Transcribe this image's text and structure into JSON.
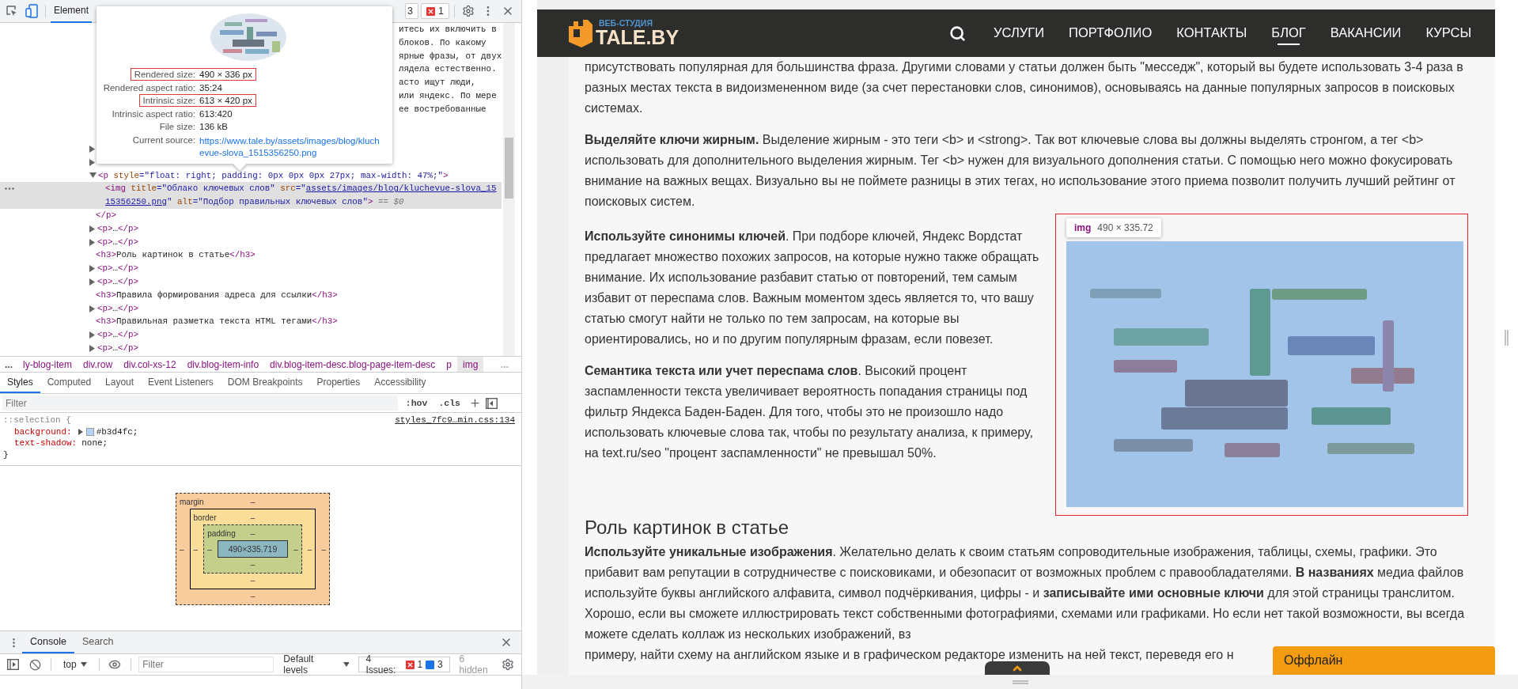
{
  "devtools": {
    "toolbar": {
      "tabs": [
        {
          "label": "Element",
          "selected": true
        }
      ],
      "warning_count": "3",
      "error_count": "1"
    },
    "tree_tail_lines": [
      "итесь их включить в",
      "блоков. По какому",
      "ярные фразы, от двух",
      "лядела естественно.",
      "асто ищут люди,",
      "или яндекс. По мере",
      "ее востребованные"
    ],
    "tree": [
      {
        "expanded": false,
        "selected": false
      },
      {
        "expanded": false,
        "selected": false
      },
      {
        "expanded": true,
        "selected": false,
        "segments": [
          {
            "kind": "tag",
            "text": "<p"
          },
          {
            "kind": "attr",
            "text": " style"
          },
          {
            "kind": "value",
            "text": "=\"float: right; padding: 0px 0px 0px 27px; max-width: 47%;\""
          },
          {
            "kind": "tag",
            "text": ">"
          }
        ],
        "closing": "</p>",
        "children": [
          {
            "selected": true,
            "segments": [
              {
                "kind": "tag",
                "text": "<img"
              },
              {
                "kind": "attr",
                "text": " title"
              },
              {
                "kind": "value",
                "text": "=\"Облако ключевых слов\""
              },
              {
                "kind": "attr",
                "text": " src"
              },
              {
                "kind": "value",
                "text": "=\""
              },
              {
                "kind": "link",
                "text": "assets/images/blog/kluchevue-slova_1515356250.png"
              },
              {
                "kind": "value",
                "text": "\""
              },
              {
                "kind": "attr",
                "text": " alt"
              },
              {
                "kind": "value",
                "text": "=\"Подбор правильных ключевых слов\""
              },
              {
                "kind": "tag",
                "text": ">"
              },
              {
                "kind": "hint",
                "text": " == $0"
              }
            ]
          }
        ]
      },
      {
        "expanded": false,
        "selected": false,
        "segments": [
          {
            "kind": "tag",
            "text": "<p>"
          },
          {
            "kind": "text",
            "text": "…"
          },
          {
            "kind": "tag",
            "text": "</p>"
          }
        ]
      },
      {
        "expanded": false,
        "selected": false,
        "segments": [
          {
            "kind": "tag",
            "text": "<p>"
          },
          {
            "kind": "text",
            "text": "…"
          },
          {
            "kind": "tag",
            "text": "</p>"
          }
        ]
      },
      {
        "selected": false,
        "segments": [
          {
            "kind": "tag",
            "text": "<h3>"
          },
          {
            "kind": "text",
            "text": "Роль картинок в статье"
          },
          {
            "kind": "tag",
            "text": "</h3>"
          }
        ]
      },
      {
        "expanded": false,
        "selected": false,
        "segments": [
          {
            "kind": "tag",
            "text": "<p>"
          },
          {
            "kind": "text",
            "text": "…"
          },
          {
            "kind": "tag",
            "text": "</p>"
          }
        ]
      },
      {
        "expanded": false,
        "selected": false,
        "segments": [
          {
            "kind": "tag",
            "text": "<p>"
          },
          {
            "kind": "text",
            "text": "…"
          },
          {
            "kind": "tag",
            "text": "</p>"
          }
        ]
      },
      {
        "selected": false,
        "segments": [
          {
            "kind": "tag",
            "text": "<h3>"
          },
          {
            "kind": "text",
            "text": "Правила формирования адреса для ссылки"
          },
          {
            "kind": "tag",
            "text": "</h3>"
          }
        ]
      },
      {
        "expanded": false,
        "selected": false,
        "segments": [
          {
            "kind": "tag",
            "text": "<p>"
          },
          {
            "kind": "text",
            "text": "…"
          },
          {
            "kind": "tag",
            "text": "</p>"
          }
        ]
      },
      {
        "selected": false,
        "segments": [
          {
            "kind": "tag",
            "text": "<h3>"
          },
          {
            "kind": "text",
            "text": "Правильная разметка текста HTML тегами"
          },
          {
            "kind": "tag",
            "text": "</h3>"
          }
        ]
      },
      {
        "expanded": false,
        "selected": false,
        "segments": [
          {
            "kind": "tag",
            "text": "<p>"
          },
          {
            "kind": "text",
            "text": "…"
          },
          {
            "kind": "tag",
            "text": "</p>"
          }
        ]
      },
      {
        "expanded": false,
        "selected": false,
        "segments": [
          {
            "kind": "tag",
            "text": "<p>"
          },
          {
            "kind": "text",
            "text": "…"
          },
          {
            "kind": "tag",
            "text": "</p>"
          }
        ]
      }
    ],
    "image_tooltip": {
      "rows": [
        {
          "label": "Rendered size:",
          "value": "490 × 336 px",
          "kind": "text",
          "highlighted": true
        },
        {
          "label": "Rendered aspect ratio:",
          "value": "35:24",
          "kind": "text",
          "highlighted": false
        },
        {
          "label": "Intrinsic size:",
          "value": "613 × 420 px",
          "kind": "text",
          "highlighted": true
        },
        {
          "label": "Intrinsic aspect ratio:",
          "value": "613:420",
          "kind": "text",
          "highlighted": false
        },
        {
          "label": "File size:",
          "value": "136 kB",
          "kind": "text",
          "highlighted": false
        },
        {
          "label": "Current source:",
          "value": "https://www.tale.by/assets/images/blog/kluchevue-slova_1515356250.png",
          "kind": "link",
          "highlighted": false
        }
      ]
    },
    "breadcrumbs": {
      "more_left": "...",
      "items": [
        {
          "label": "ly-blog-item",
          "selected": false
        },
        {
          "label": "div.row",
          "selected": false
        },
        {
          "label": "div.col-xs-12",
          "selected": false
        },
        {
          "label": "div.blog-item-info",
          "selected": false
        },
        {
          "label": "div.blog-item-desc.blog-page-item-desc",
          "selected": false
        },
        {
          "label": "p",
          "selected": false
        },
        {
          "label": "img",
          "selected": true
        }
      ],
      "more_right": "..."
    },
    "sidebar_tabs": [
      {
        "label": "Styles",
        "selected": true
      },
      {
        "label": "Computed",
        "selected": false
      },
      {
        "label": "Layout",
        "selected": false
      },
      {
        "label": "Event Listeners",
        "selected": false
      },
      {
        "label": "DOM Breakpoints",
        "selected": false
      },
      {
        "label": "Properties",
        "selected": false
      },
      {
        "label": "Accessibility",
        "selected": false
      }
    ],
    "styles_filter": {
      "placeholder": "Filter",
      "buttons": [
        ":hov",
        ".cls"
      ]
    },
    "rule": {
      "selector": "::selection {",
      "source": "styles_7fc9…min.css:134",
      "declarations": [
        {
          "property": "background:",
          "value": "#b3d4fc;",
          "color": "#b3d4fc"
        },
        {
          "property": "text-shadow:",
          "value": "none;"
        }
      ],
      "close": "}"
    },
    "box_model": {
      "margin": {
        "label": "margin",
        "top": "–",
        "left": "–",
        "right": "–",
        "bottom": "–"
      },
      "border": {
        "label": "border",
        "top": "–",
        "left": "–",
        "right": "–",
        "bottom": "–"
      },
      "padding": {
        "label": "padding",
        "top": "–",
        "left": "–",
        "right": "–",
        "bottom": "–"
      },
      "content": "490×335.719"
    },
    "drawer": {
      "tabs": [
        {
          "label": "Console",
          "selected": true
        },
        {
          "label": "Search",
          "selected": false
        }
      ],
      "context": "top",
      "filter_placeholder": "Filter",
      "levels": "Default levels",
      "issues_label": "4 Issues:",
      "issue_errors": "1",
      "issue_infos": "3",
      "hidden": "6 hidden"
    }
  },
  "website": {
    "logo": {
      "tagline": "ВЕБ-СТУДИЯ",
      "name": "TALE.BY"
    },
    "nav": [
      {
        "label": "УСЛУГИ",
        "selected": false
      },
      {
        "label": "ПОРТФОЛИО",
        "selected": false
      },
      {
        "label": "КОНТАКТЫ",
        "selected": false
      },
      {
        "label": "БЛОГ",
        "selected": true
      },
      {
        "label": "ВАКАНСИИ",
        "selected": false
      },
      {
        "label": "КУРСЫ",
        "selected": false
      }
    ],
    "paragraphs_top": [
      "присутствовать популярная для большинства фраза. Другими словами у статьи должен быть \"месседж\", который вы будете использовать 3-4 раза в разных местах текста в видоизмененном виде (за счет перестановки слов, синонимов), основываясь на данные популярных запросов в поисковых системах.",
      "**Выделяйте ключи жирным.** Выделение жирным - это теги <b> и <strong>. Так вот ключевые слова вы должны выделять стронгом, а тег <b> использовать для дополнительного выделения жирным. Тег <b> нужен для визуального дополнения статьи. С помощью него можно фокусировать внимание на важных вещах. Визуально вы не поймете разницы в этих тегах, но использование этого приема позволит получить лучший рейтинг от поисковых систем."
    ],
    "figure": {
      "badge_tag": "img",
      "badge_size": "490 × 335.72"
    },
    "side_paragraphs": [
      "**Используйте синонимы ключей**. При подборе ключей, Яндекс Вордстат предлагает множество похожих запросов, на которые нужно также обращать внимание. Их использование разбавит статью от повторений, тем самым избавит от переспама слов. Важным моментом здесь является то, что вашу статью смогут найти не только по тем запросам, на которые вы ориентировались, но и по другим популярным фразам, если повезет.",
      "**Семантика текста или учет переспама слов**. Высокий процент заспамленности текста увеличивает вероятность попадания страницы под фильтр Яндекса Баден-Баден. Для того, чтобы это не произошло надо использовать ключевые слова так, чтобы по результату анализа, к примеру, на text.ru/seo \"процент заспамленности\" не превышал 50%."
    ],
    "heading": "Роль картинок в статье",
    "paragraphs_bottom": [
      "**Используйте уникальные изображения**. Желательно делать к своим статьям сопроводительные изображения, таблицы, схемы, графики. Это прибавит вам репутации в сотрудничестве с поисковиками, и обезопасит от возможных проблем с правообладателями. **В названиях** медиа файлов используйте буквы английского алфавита, символ подчёркивания, цифры - и **записывайте ими основные ключи** для этой страницы транслитом. Хорошо, если вы сможете иллюстрировать текст собственными фотографиями, схемами или графиками. Но если нет такой возможности, вы всегда можете сделать коллаж из нескольких изображений, вз",
      "примеру, найти схему на английском языке и в графическом редакторе изменить на ней текст, переведя его н"
    ],
    "chat": {
      "label": "Оффлайн"
    }
  }
}
